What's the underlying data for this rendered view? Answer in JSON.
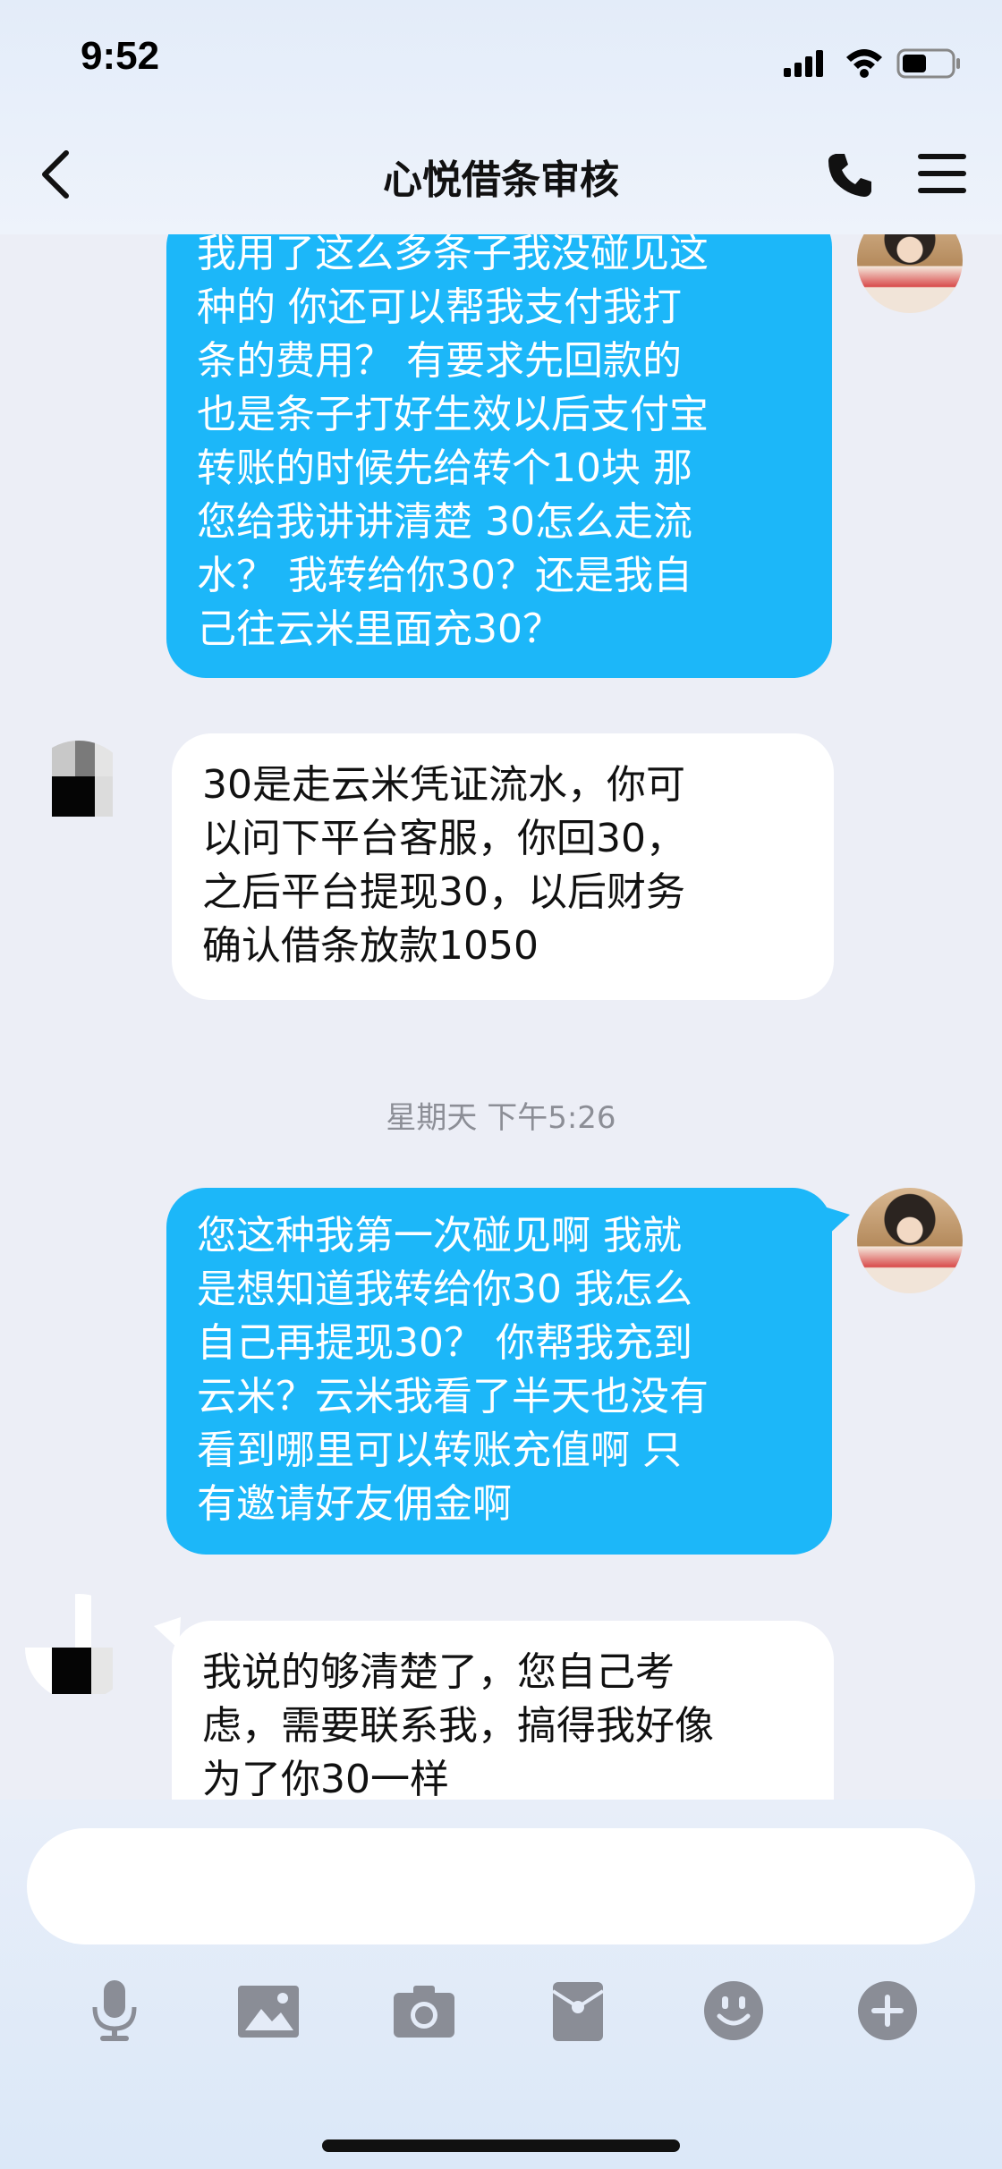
{
  "status_bar": {
    "time": "9:52"
  },
  "header": {
    "title": "心悦借条审核"
  },
  "messages": [
    {
      "sender": "me",
      "text": "我用了这么多条子我没碰见这\n种的   你还可以帮我支付我打\n条的费用？    有要求先回款的\n也是条子打好生效以后支付宝\n转账的时候先给转个10块   那\n您给我讲讲清楚  30怎么走流\n水？  我转给你30？还是我自\n己往云米里面充30？"
    },
    {
      "sender": "them",
      "text": "30是走云米凭证流水，你可\n以问下平台客服，你回30，\n之后平台提现30，以后财务\n确认借条放款1050"
    },
    {
      "sender": "me",
      "text": "您这种我第一次碰见啊  我就\n是想知道我转给你30  我怎么\n自己再提现30？  你帮我充到\n云米？云米我看了半天也没有\n看到哪里可以转账充值啊   只\n有邀请好友佣金啊"
    },
    {
      "sender": "them",
      "text": "我说的够清楚了，您自己考\n虑，需要联系我，搞得我好像\n为了你30一样"
    }
  ],
  "timestamp": "星期天 下午5:26",
  "input": {
    "placeholder": ""
  },
  "toolbar": [
    "microphone-icon",
    "image-icon",
    "camera-icon",
    "red-packet-icon",
    "emoji-icon",
    "plus-icon"
  ],
  "colors": {
    "my_bubble": "#1cb7f9",
    "their_bubble": "#ffffff",
    "background": "#eceef6",
    "icon_gray": "#8a8d96"
  }
}
